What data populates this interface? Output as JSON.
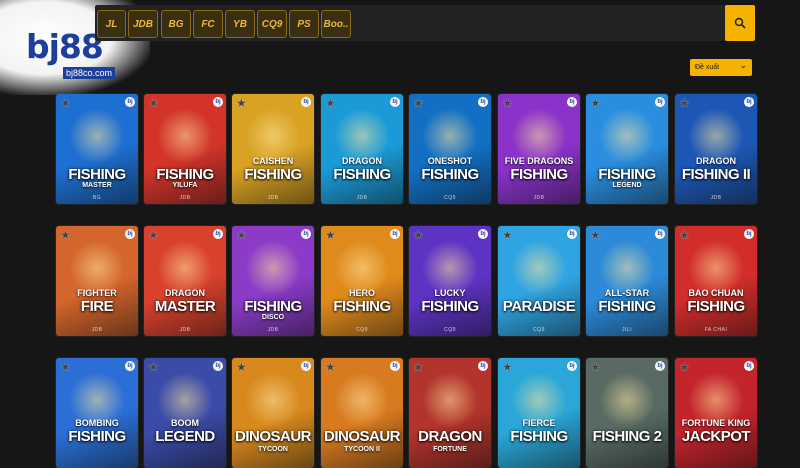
{
  "brand": {
    "name": "bj88",
    "url": "bj88co.com"
  },
  "providers": [
    "JL",
    "JDB",
    "BG",
    "FC",
    "YB",
    "CQ9",
    "PS",
    "Boo.."
  ],
  "sort": {
    "label": "Đề xuất"
  },
  "colors": {
    "accent": "#f5b300",
    "background": "#161616",
    "brand_blue": "#1d3f9a"
  },
  "games": [
    {
      "top": "",
      "main": "FISHING",
      "sub": "MASTER",
      "provider": "BG"
    },
    {
      "top": "",
      "main": "FISHING",
      "sub": "YILUFA",
      "provider": "JDB"
    },
    {
      "top": "CAISHEN",
      "main": "FISHING",
      "sub": "",
      "provider": "JDB"
    },
    {
      "top": "DRAGON",
      "main": "FISHING",
      "sub": "",
      "provider": "JDB"
    },
    {
      "top": "ONESHOT",
      "main": "FISHING",
      "sub": "",
      "provider": "CQ9"
    },
    {
      "top": "FIVE DRAGONS",
      "main": "FISHING",
      "sub": "",
      "provider": "JDB"
    },
    {
      "top": "",
      "main": "FISHING",
      "sub": "LEGEND",
      "provider": ""
    },
    {
      "top": "DRAGON",
      "main": "FISHING II",
      "sub": "",
      "provider": "JDB"
    },
    {
      "top": "FIGHTER",
      "main": "FIRE",
      "sub": "",
      "provider": "JDB"
    },
    {
      "top": "DRAGON",
      "main": "MASTER",
      "sub": "",
      "provider": "JDB"
    },
    {
      "top": "",
      "main": "FISHING",
      "sub": "DISCO",
      "provider": "JDB"
    },
    {
      "top": "HERO",
      "main": "FISHING",
      "sub": "",
      "provider": "CQ9"
    },
    {
      "top": "LUCKY",
      "main": "FISHING",
      "sub": "",
      "provider": "CQ9"
    },
    {
      "top": "",
      "main": "PARADISE",
      "sub": "",
      "provider": "CQ9"
    },
    {
      "top": "ALL-STAR",
      "main": "FISHING",
      "sub": "",
      "provider": "JILI"
    },
    {
      "top": "BAO CHUAN",
      "main": "FISHING",
      "sub": "",
      "provider": "FA CHAI"
    },
    {
      "top": "BOMBING",
      "main": "FISHING",
      "sub": "",
      "provider": ""
    },
    {
      "top": "BOOM",
      "main": "LEGEND",
      "sub": "",
      "provider": ""
    },
    {
      "top": "",
      "main": "DINOSAUR",
      "sub": "TYCOON",
      "provider": ""
    },
    {
      "top": "",
      "main": "DINOSAUR",
      "sub": "TYCOON II",
      "provider": ""
    },
    {
      "top": "",
      "main": "DRAGON",
      "sub": "FORTUNE",
      "provider": ""
    },
    {
      "top": "FIERCE",
      "main": "FISHING",
      "sub": "",
      "provider": ""
    },
    {
      "top": "",
      "main": "FISHING 2",
      "sub": "",
      "provider": ""
    },
    {
      "top": "FORTUNE KING",
      "main": "JACKPOT",
      "sub": "",
      "provider": ""
    }
  ],
  "tile_colors": [
    "#1d6fd1",
    "#d2342a",
    "#d9a223",
    "#1a9bd8",
    "#126fc4",
    "#8a32c9",
    "#2a8ee0",
    "#1d57b5",
    "#d4652c",
    "#d8412c",
    "#8b3bc8",
    "#e08a1c",
    "#5d33c4",
    "#2fa4e2",
    "#2c8ad9",
    "#d22d2a",
    "#2b6fd6",
    "#3b4ba8",
    "#d8891e",
    "#d87a1f",
    "#b3342c",
    "#2aa7d8",
    "#586a63",
    "#c4242c"
  ]
}
